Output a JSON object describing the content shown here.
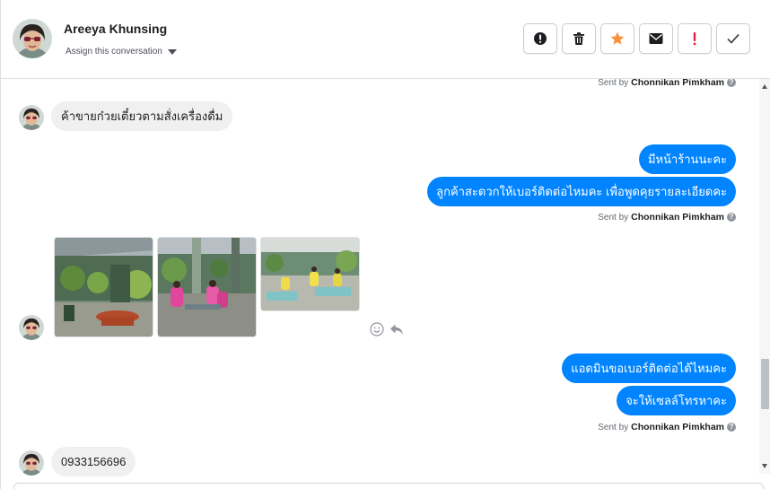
{
  "header": {
    "contact_name": "Areeya Khunsing",
    "assign_label": "Assign this conversation",
    "avatar_icon": "contact-avatar",
    "actions": [
      {
        "name": "mark-spam-button",
        "icon": "alert-circle-icon"
      },
      {
        "name": "delete-button",
        "icon": "trash-icon"
      },
      {
        "name": "star-button",
        "icon": "star-icon",
        "color": "#f7923b"
      },
      {
        "name": "mark-unread-button",
        "icon": "envelope-icon"
      },
      {
        "name": "flag-important-button",
        "icon": "exclamation-icon",
        "color": "#e41e3f"
      },
      {
        "name": "mark-done-button",
        "icon": "checkmark-icon"
      }
    ]
  },
  "messages": {
    "sent_by_prefix": "Sent by",
    "agent_name": "Chonnikan Pimkham",
    "incoming_1": "ค้าขายก๋วยเตี๋ยวตามสั่งเครื่องดื่ม",
    "outgoing_1": "มีหน้าร้านนะคะ",
    "outgoing_2": "ลูกค้าสะดวกให้เบอร์ติดต่อไหมคะ เพื่อพูดคุยรายละเอียดคะ",
    "incoming_photos": [
      "photo-restaurant-exterior",
      "photo-customers-seated",
      "photo-dining-area"
    ],
    "outgoing_3": "แอดมินขอเบอร์ติดต่อได้ไหมคะ",
    "outgoing_4": "จะให้เซลล์โทรหาคะ",
    "incoming_2": "0933156696"
  },
  "colors": {
    "outgoing_bubble": "#0084ff",
    "incoming_bubble": "#f1f0f0",
    "star": "#f7923b",
    "important": "#e41e3f"
  }
}
